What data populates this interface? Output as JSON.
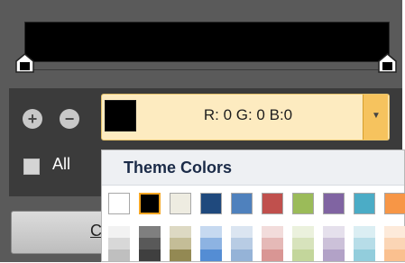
{
  "color_picker": {
    "rgb_text": "R: 0 G: 0 B:0",
    "selected_color": "#000000"
  },
  "options": {
    "all_label": "All",
    "close_label_visible": "C"
  },
  "theme_popup": {
    "title": "Theme Colors",
    "colors": [
      "#ffffff",
      "#000000",
      "#eeece1",
      "#1f497d",
      "#4f81bd",
      "#c0504d",
      "#9bbb59",
      "#8064a2",
      "#4bacc6",
      "#f79646"
    ],
    "shade_rows": [
      [
        "#f2f2f2",
        "#7f7f7f",
        "#ddd9c3",
        "#c6d9f0",
        "#dbe5f1",
        "#f2dcdb",
        "#ebf1dd",
        "#e5e0ec",
        "#dbeef3",
        "#fdeada"
      ],
      [
        "#d8d8d8",
        "#595959",
        "#c4bd97",
        "#8db3e2",
        "#b8cce4",
        "#e5b9b7",
        "#d7e3bc",
        "#ccc1d9",
        "#b7dde8",
        "#fbd5b5"
      ],
      [
        "#bfbfbf",
        "#3f3f3f",
        "#938953",
        "#548dd4",
        "#95b3d7",
        "#d99694",
        "#c3d69b",
        "#b2a2c7",
        "#92cddc",
        "#fac08f"
      ]
    ]
  }
}
